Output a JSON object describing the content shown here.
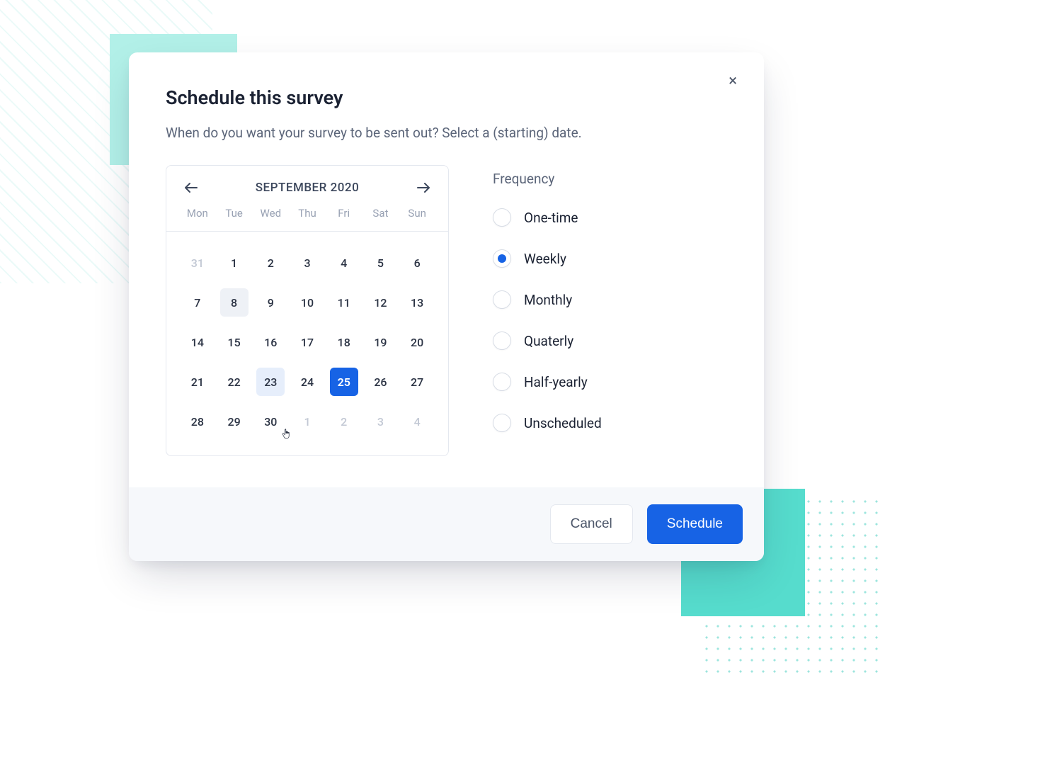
{
  "modal": {
    "title": "Schedule this survey",
    "subtitle": "When do you want your survey to be sent out? Select a (starting) date.",
    "close_icon": "×"
  },
  "calendar": {
    "month_label": "SEPTEMBER 2020",
    "dow": [
      "Mon",
      "Tue",
      "Wed",
      "Thu",
      "Fri",
      "Sat",
      "Sun"
    ],
    "days": [
      {
        "n": "31",
        "muted": true
      },
      {
        "n": "1"
      },
      {
        "n": "2"
      },
      {
        "n": "3"
      },
      {
        "n": "4"
      },
      {
        "n": "5"
      },
      {
        "n": "6"
      },
      {
        "n": "7"
      },
      {
        "n": "8",
        "today": true
      },
      {
        "n": "9"
      },
      {
        "n": "10"
      },
      {
        "n": "11"
      },
      {
        "n": "12"
      },
      {
        "n": "13"
      },
      {
        "n": "14"
      },
      {
        "n": "15"
      },
      {
        "n": "16"
      },
      {
        "n": "17"
      },
      {
        "n": "18"
      },
      {
        "n": "19"
      },
      {
        "n": "20"
      },
      {
        "n": "21"
      },
      {
        "n": "22"
      },
      {
        "n": "23",
        "hover": true
      },
      {
        "n": "24"
      },
      {
        "n": "25",
        "selected": true
      },
      {
        "n": "26"
      },
      {
        "n": "27"
      },
      {
        "n": "28"
      },
      {
        "n": "29"
      },
      {
        "n": "30"
      },
      {
        "n": "1",
        "muted": true
      },
      {
        "n": "2",
        "muted": true
      },
      {
        "n": "3",
        "muted": true
      },
      {
        "n": "4",
        "muted": true
      }
    ]
  },
  "frequency": {
    "title": "Frequency",
    "options": [
      {
        "label": "One-time",
        "checked": false
      },
      {
        "label": "Weekly",
        "checked": true
      },
      {
        "label": "Monthly",
        "checked": false
      },
      {
        "label": "Quaterly",
        "checked": false
      },
      {
        "label": "Half-yearly",
        "checked": false
      },
      {
        "label": "Unscheduled",
        "checked": false
      }
    ]
  },
  "footer": {
    "cancel": "Cancel",
    "schedule": "Schedule"
  }
}
